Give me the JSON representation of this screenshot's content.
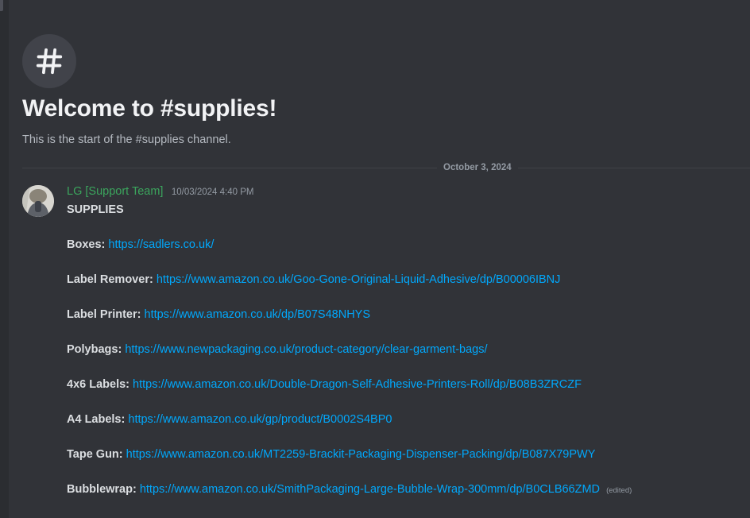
{
  "colors": {
    "background": "#313338",
    "link": "#00a8fc",
    "author": "#3ba55d",
    "muted": "#949ba4"
  },
  "welcome": {
    "icon": "hash-icon",
    "title": "Welcome to #supplies!",
    "subtitle": "This is the start of the #supplies channel."
  },
  "divider": {
    "date": "October 3, 2024"
  },
  "message": {
    "author": "LG [Support Team]",
    "timestamp": "10/03/2024 4:40 PM",
    "title": "SUPPLIES",
    "items": [
      {
        "label": "Boxes:",
        "url": "https://sadlers.co.uk/"
      },
      {
        "label": "Label Remover:",
        "url": "https://www.amazon.co.uk/Goo-Gone-Original-Liquid-Adhesive/dp/B00006IBNJ"
      },
      {
        "label": "Label Printer:",
        "url": "https://www.amazon.co.uk/dp/B07S48NHYS"
      },
      {
        "label": "Polybags:",
        "url": "https://www.newpackaging.co.uk/product-category/clear-garment-bags/"
      },
      {
        "label": "4x6 Labels:",
        "url": "https://www.amazon.co.uk/Double-Dragon-Self-Adhesive-Printers-Roll/dp/B08B3ZRCZF"
      },
      {
        "label": "A4 Labels:",
        "url": "https://www.amazon.co.uk/gp/product/B0002S4BP0"
      },
      {
        "label": "Tape Gun:",
        "url": "https://www.amazon.co.uk/MT2259-Brackit-Packaging-Dispenser-Packing/dp/B087X79PWY"
      },
      {
        "label": "Bubblewrap:",
        "url": "https://www.amazon.co.uk/SmithPackaging-Large-Bubble-Wrap-300mm/dp/B0CLB66ZMD"
      }
    ],
    "edited_tag": "(edited)"
  }
}
